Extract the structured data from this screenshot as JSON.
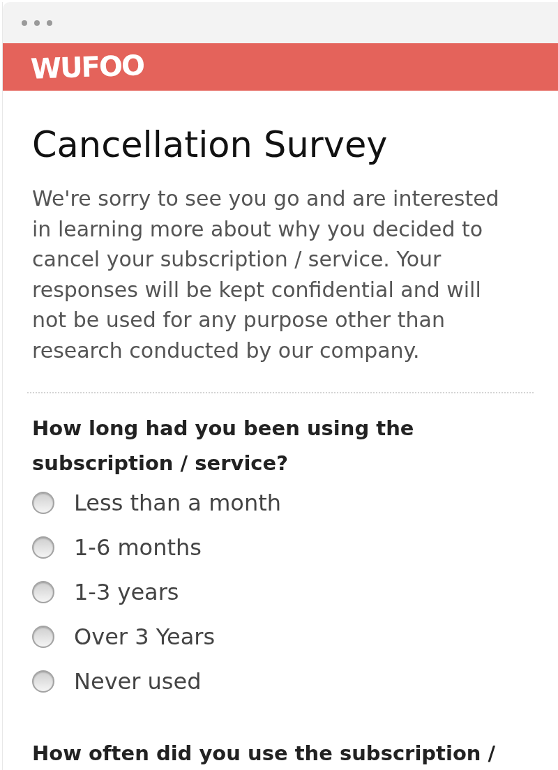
{
  "header": {
    "logo": "WUFOO"
  },
  "form": {
    "title": "Cancellation Survey",
    "description": "We're sorry to see you go and are interested in learning more about why you decided to cancel your subscription / service. Your responses will be kept confidential and will not be used for any purpose other than research conducted by our company.",
    "questions": [
      {
        "label": "How long had you been using the subscription / service?",
        "options": [
          {
            "label": "Less than a month",
            "selected": false
          },
          {
            "label": "1-6 months",
            "selected": false
          },
          {
            "label": "1-3 years",
            "selected": false
          },
          {
            "label": "Over 3 Years",
            "selected": false
          },
          {
            "label": "Never used",
            "selected": false
          }
        ]
      },
      {
        "label": "How often did you use the subscription /"
      }
    ]
  }
}
